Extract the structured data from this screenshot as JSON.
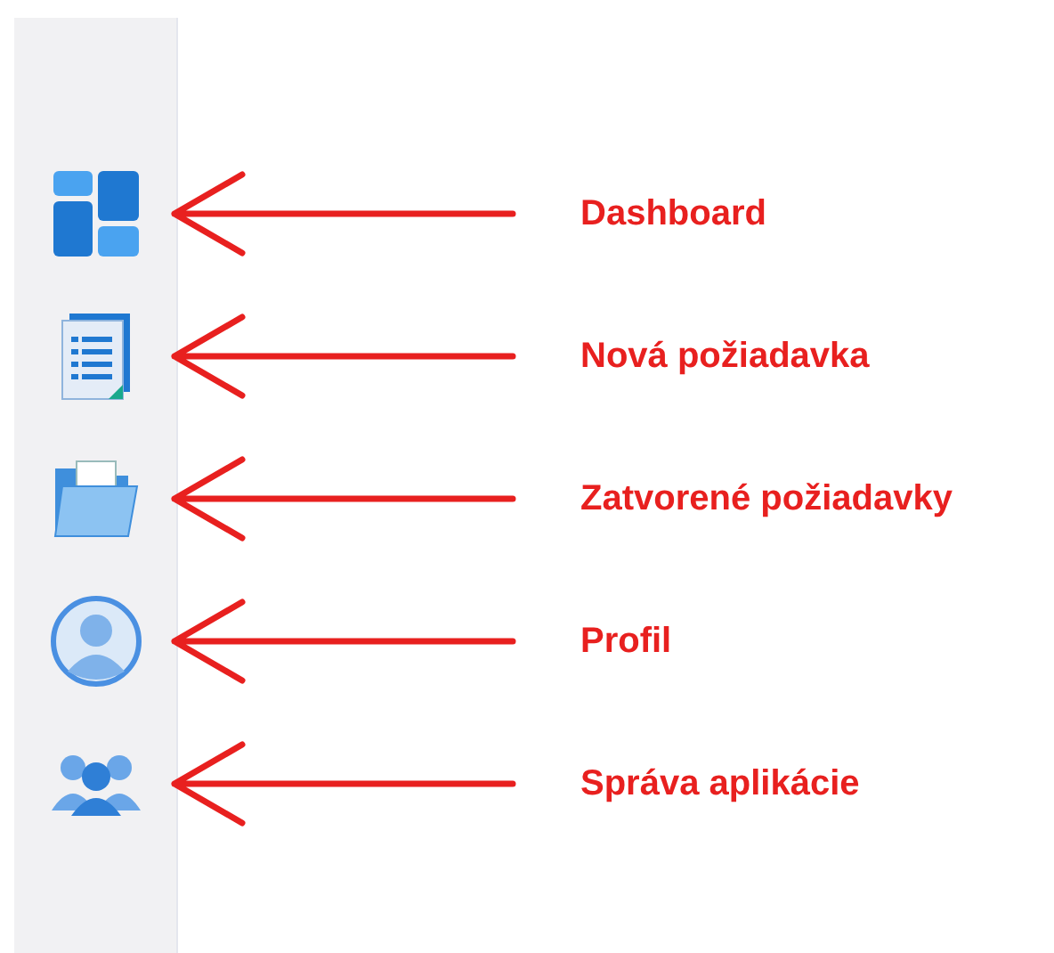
{
  "sidebar": {
    "items": [
      {
        "kind": "dashboard",
        "annotation": "Dashboard"
      },
      {
        "kind": "document",
        "annotation": "Nová požiadavka"
      },
      {
        "kind": "folder",
        "annotation": "Zatvorené požiadavky"
      },
      {
        "kind": "profile",
        "annotation": "Profil"
      },
      {
        "kind": "team",
        "annotation": "Správa aplikácie"
      }
    ]
  }
}
